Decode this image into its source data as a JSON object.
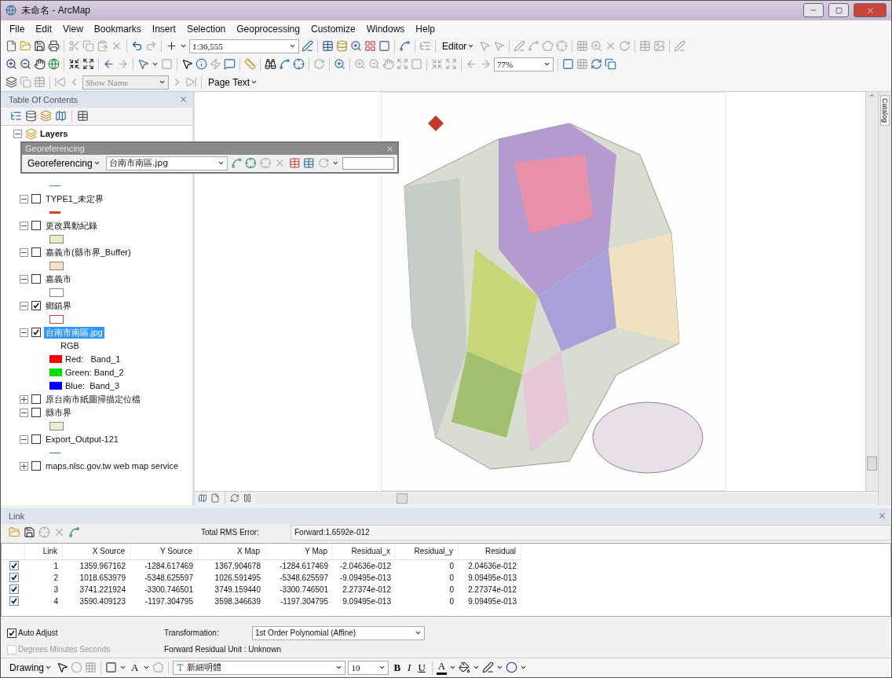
{
  "window": {
    "title": "未命名 - ArcMap"
  },
  "menu": [
    "File",
    "Edit",
    "View",
    "Bookmarks",
    "Insert",
    "Selection",
    "Geoprocessing",
    "Customize",
    "Windows",
    "Help"
  ],
  "standard_toolbar": {
    "scale": "1:36,555"
  },
  "editor_toolbar": {
    "label": "Editor"
  },
  "layout_toolbar": {
    "zoom": "77%"
  },
  "text_toolbar": {
    "field": "Show Name",
    "page_text": "Page Text"
  },
  "toc": {
    "title": "Table Of Contents",
    "root": "Layers",
    "layers": [
      {
        "legend": {
          "kind": "line",
          "color": "#3a9a5a"
        }
      },
      {
        "name": "TYPE1_未定界",
        "checked": false,
        "expanded": true,
        "selected": false,
        "legend": {
          "kind": "thick",
          "color": "#e03a20"
        }
      },
      {
        "name": "更改異動紀錄",
        "checked": false,
        "expanded": true,
        "selected": false,
        "legend": {
          "kind": "fill",
          "color": "#e4f0c0"
        }
      },
      {
        "name": "嘉義市(縣市界_Buffer)",
        "checked": false,
        "expanded": true,
        "selected": false,
        "legend": {
          "kind": "fill",
          "color": "#f8e0c4"
        }
      },
      {
        "name": "嘉義市",
        "checked": false,
        "expanded": true,
        "selected": false,
        "legend": {
          "kind": "fill",
          "color": "#ffffff"
        }
      },
      {
        "name": "鄉鎮界",
        "checked": true,
        "expanded": true,
        "selected": false,
        "legend": {
          "kind": "outline",
          "color": "#d04040"
        }
      },
      {
        "name": "台南市南區.jpg",
        "checked": true,
        "expanded": true,
        "selected": true,
        "legend": {
          "kind": "rgb",
          "title": "RGB",
          "bands": [
            {
              "color": "#ff0000",
              "channel": "Red:",
              "band": "Band_1"
            },
            {
              "color": "#00e000",
              "channel": "Green:",
              "band": "Band_2"
            },
            {
              "color": "#0000ff",
              "channel": "Blue:",
              "band": "Band_3"
            }
          ]
        }
      },
      {
        "name": "原台南市紙圖掃描定位檔",
        "checked": false,
        "expanded": false,
        "selected": false
      },
      {
        "name": "縣市界",
        "checked": false,
        "expanded": true,
        "selected": false,
        "legend": {
          "kind": "fill",
          "color": "#e6f0d0"
        }
      },
      {
        "name": "Export_Output-121",
        "checked": false,
        "expanded": true,
        "selected": false,
        "legend": {
          "kind": "line",
          "color": "#3070a0"
        }
      },
      {
        "name": "maps.nlsc.gov.tw web map service",
        "checked": false,
        "expanded": false,
        "selected": false
      }
    ]
  },
  "georeferencing": {
    "title": "Georeferencing",
    "menu": "Georeferencing",
    "layer": "台南市南區.jpg"
  },
  "side_tabs": [
    "Catalog"
  ],
  "link_panel": {
    "title": "Link",
    "rms_label": "Total RMS Error:",
    "rms_value": "Forward:1.6592e-012",
    "columns": [
      "Link",
      "X Source",
      "Y Source",
      "X Map",
      "Y Map",
      "Residual_x",
      "Residual_y",
      "Residual"
    ],
    "rows": [
      {
        "checked": true,
        "cells": [
          "1",
          "1359.967162",
          "-1284.617469",
          "1367.904678",
          "-1284.617469",
          "-2.04636e-012",
          "0",
          "2.04636e-012"
        ]
      },
      {
        "checked": true,
        "cells": [
          "2",
          "1018.653979",
          "-5348.625597",
          "1026.591495",
          "-5348.625597",
          "-9.09495e-013",
          "0",
          "9.09495e-013"
        ]
      },
      {
        "checked": true,
        "cells": [
          "3",
          "3741.221924",
          "-3300.746501",
          "3749.159440",
          "-3300.746501",
          "2.27374e-012",
          "0",
          "2.27374e-012"
        ]
      },
      {
        "checked": true,
        "cells": [
          "4",
          "3590.409123",
          "-1197.304795",
          "3598.346639",
          "-1197.304795",
          "9.09495e-013",
          "0",
          "9.09495e-013"
        ]
      }
    ],
    "auto_adjust": {
      "label": "Auto Adjust",
      "checked": true,
      "disabled": false
    },
    "dms": {
      "label": "Degrees Minutes Seconds",
      "checked": false,
      "disabled": true
    },
    "transformation_label": "Transformation:",
    "transformation": "1st Order Polynomial (Affine)",
    "unit": "Forward Residual Unit : Unknown"
  },
  "drawing_toolbar": {
    "label": "Drawing",
    "text_tool": "A",
    "font": "新細明體",
    "size": "10",
    "bold": "B",
    "italic": "I",
    "underline": "U",
    "font_color": "A"
  }
}
